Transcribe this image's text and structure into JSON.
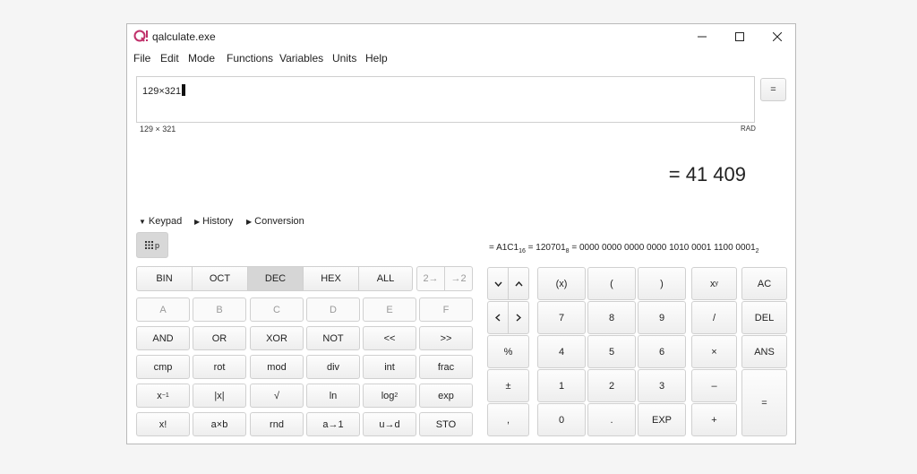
{
  "window": {
    "title": "qalculate.exe",
    "minimize": "–",
    "maximize": "☐",
    "close": "✕"
  },
  "menu": [
    "File",
    "Edit",
    "Mode",
    "Functions",
    "Variables",
    "Units",
    "Help"
  ],
  "expression": {
    "value": "129×321",
    "parsed": "129 × 321",
    "angle_unit": "RAD",
    "equals_label": "="
  },
  "result": "= 41 409",
  "sections": {
    "keypad": "Keypad",
    "history": "History",
    "conversion": "Conversion"
  },
  "keypad_toggle": "p",
  "conversion": {
    "hex": "A1C1",
    "hex_base": "16",
    "oct": "120701",
    "oct_base": "8",
    "bin": "0000 0000 0000 0000 1010 0001 1100 0001",
    "bin_base": "2"
  },
  "base_buttons": [
    "BIN",
    "OCT",
    "DEC",
    "HEX",
    "ALL"
  ],
  "shift_buttons": [
    "2→",
    "→2"
  ],
  "hex_digits": [
    "A",
    "B",
    "C",
    "D",
    "E",
    "F"
  ],
  "logic_buttons": [
    "AND",
    "OR",
    "XOR",
    "NOT",
    "<<",
    ">>"
  ],
  "func_row1": [
    "cmp",
    "rot",
    "mod",
    "div",
    "int",
    "frac"
  ],
  "func_row2": {
    "inv": "x",
    "inv_exp": "−1",
    "abs": "|x|",
    "sqrt": "√",
    "ln": "ln",
    "log": "log",
    "log_base": "2",
    "exp": "exp"
  },
  "func_row3": [
    "x!",
    "a×b",
    "rnd",
    "a→1",
    "u→d",
    "STO"
  ],
  "numpad": {
    "paren_pair": "(x)",
    "lparen": "(",
    "rparen": ")",
    "power": "x",
    "power_exp": "y",
    "ac": "AC",
    "seven": "7",
    "eight": "8",
    "nine": "9",
    "divide": "/",
    "del": "DEL",
    "percent": "%",
    "four": "4",
    "five": "5",
    "six": "6",
    "multiply": "×",
    "ans": "ANS",
    "plusminus": "±",
    "one": "1",
    "two": "2",
    "three": "3",
    "minus": "–",
    "equals": "=",
    "comma": ",",
    "zero": "0",
    "dot": ".",
    "exp": "EXP",
    "plus": "+"
  }
}
